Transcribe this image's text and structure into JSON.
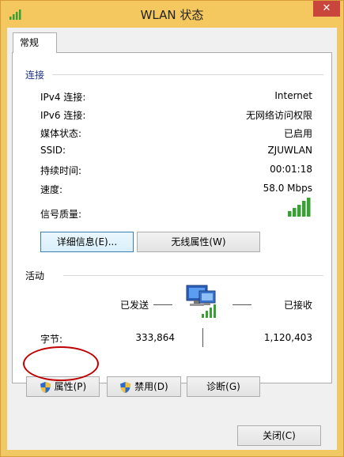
{
  "window": {
    "title": "WLAN 状态",
    "close_glyph": "✕"
  },
  "tab": {
    "label": "常规"
  },
  "connection": {
    "header": "连接",
    "rows": [
      {
        "label": "IPv4 连接:",
        "value": "Internet"
      },
      {
        "label": "IPv6 连接:",
        "value": "无网络访问权限"
      },
      {
        "label": "媒体状态:",
        "value": "已启用"
      },
      {
        "label": "SSID:",
        "value": "ZJUWLAN"
      },
      {
        "label": "持续时间:",
        "value": "00:01:18"
      },
      {
        "label": "速度:",
        "value": "58.0 Mbps"
      }
    ],
    "signal_label": "信号质量:",
    "signal_bars": 5,
    "details_button": "详细信息(E)...",
    "wireless_props_button": "无线属性(W)"
  },
  "activity": {
    "header": "活动",
    "sent_label": "已发送",
    "received_label": "已接收",
    "bytes_label": "字节:",
    "bytes_sent": "333,864",
    "bytes_received": "1,120,403"
  },
  "buttons": {
    "properties": "属性(P)",
    "disable": "禁用(D)",
    "diagnose": "诊断(G)",
    "close": "关闭(C)"
  },
  "colors": {
    "signal": "#3aa035",
    "header_text": "#1e3287",
    "annotation": "#c00000",
    "title_bar": "#f4c85e"
  }
}
